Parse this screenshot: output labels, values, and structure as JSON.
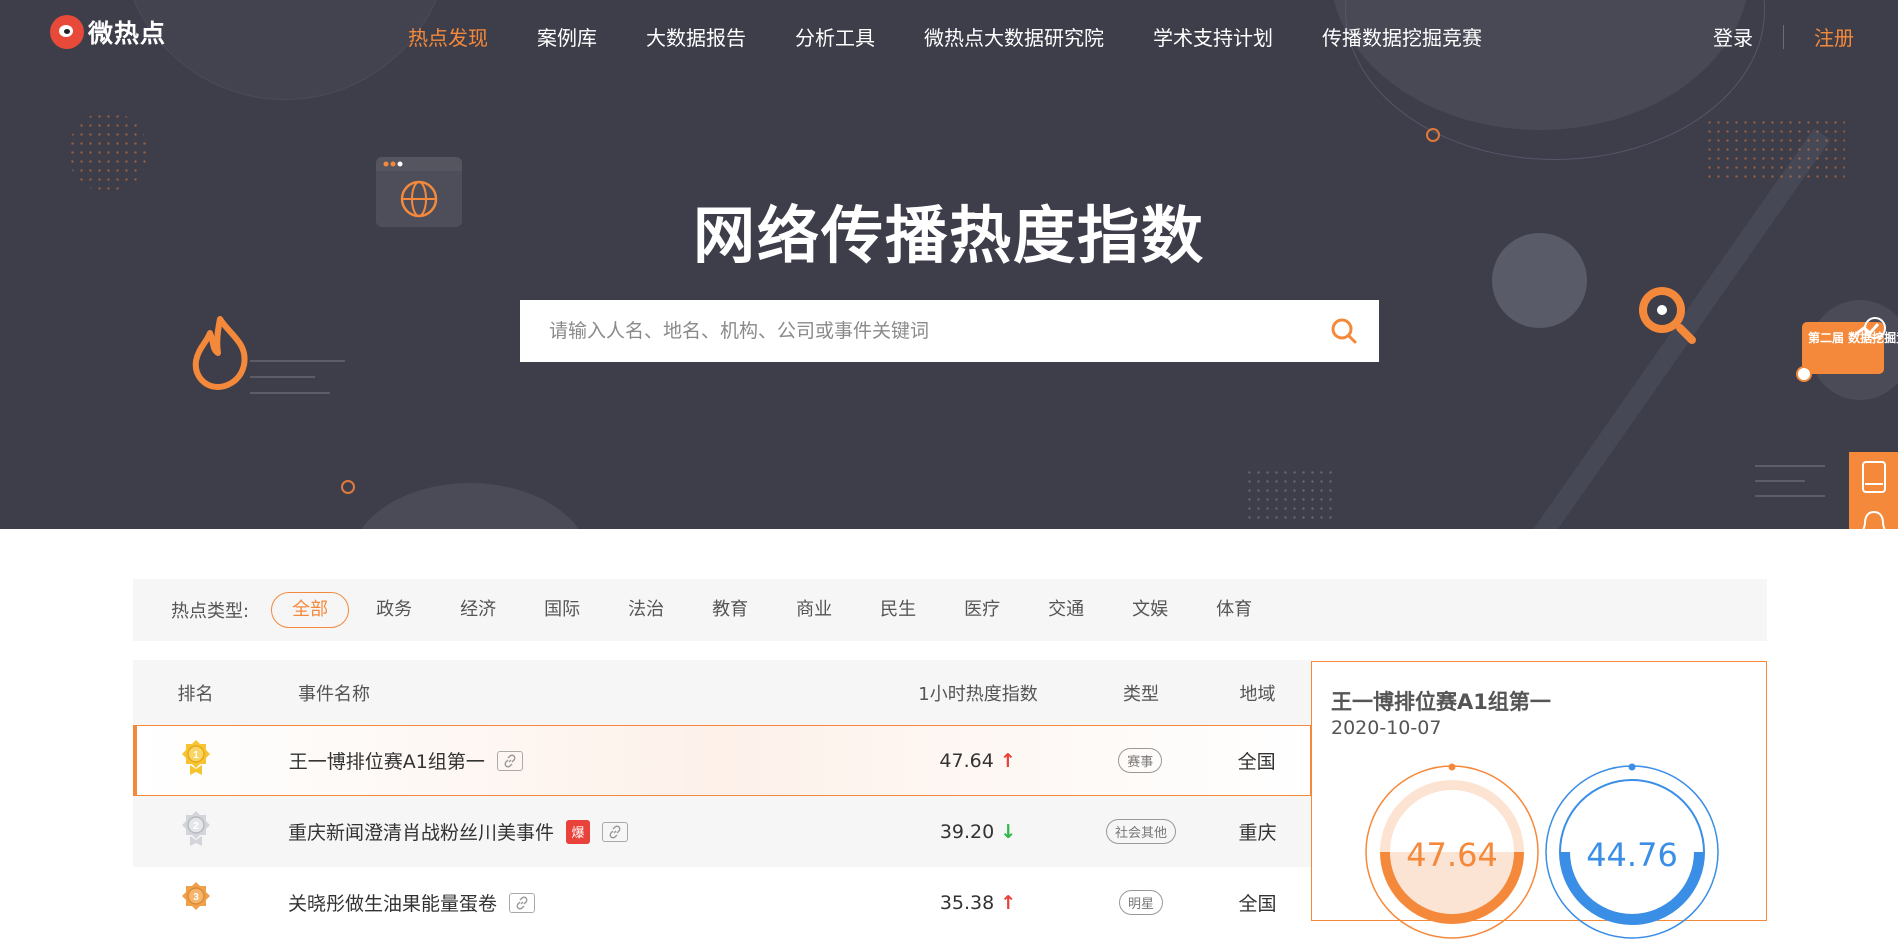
{
  "nav": {
    "logo_text": "微热点",
    "links": [
      "热点发现",
      "案例库",
      "大数据报告",
      "分析工具",
      "微热点大数据研究院",
      "学术支持计划",
      "传播数据挖掘竞赛"
    ],
    "login": "登录",
    "register": "注册"
  },
  "hero": {
    "title": "网络传播热度指数",
    "search_placeholder": "请输入人名、地名、机构、公司或事件关键词",
    "contest_badge": "第二届 数据挖掘竞赛"
  },
  "filter": {
    "label": "热点类型:",
    "options": [
      "全部",
      "政务",
      "经济",
      "国际",
      "法治",
      "教育",
      "商业",
      "民生",
      "医疗",
      "交通",
      "文娱",
      "体育"
    ],
    "selected": "全部"
  },
  "table": {
    "headers": [
      "排名",
      "事件名称",
      "1小时热度指数",
      "类型",
      "地域"
    ],
    "rows": [
      {
        "rank": 1,
        "name": "王一博排位赛A1组第一",
        "index": "47.64",
        "trend": "up",
        "type": "赛事",
        "region": "全国",
        "hot": false
      },
      {
        "rank": 2,
        "name": "重庆新闻澄清肖战粉丝川美事件",
        "index": "39.20",
        "trend": "down",
        "type": "社会其他",
        "region": "重庆",
        "hot": true,
        "hot_label": "爆"
      },
      {
        "rank": 3,
        "name": "关晓彤做生油果能量蛋卷",
        "index": "35.38",
        "trend": "up",
        "type": "明星",
        "region": "全国",
        "hot": false
      }
    ]
  },
  "detail": {
    "title": "王一博排位赛A1组第一",
    "date": "2020-10-07",
    "gauges": [
      {
        "value": "47.64",
        "color": "#f5893b"
      },
      {
        "value": "44.76",
        "color": "#3a8ee6"
      }
    ]
  },
  "colors": {
    "accent": "#f5893b",
    "hero_bg": "#3d3e4a",
    "up": "#e8423a",
    "down": "#2db84c"
  }
}
